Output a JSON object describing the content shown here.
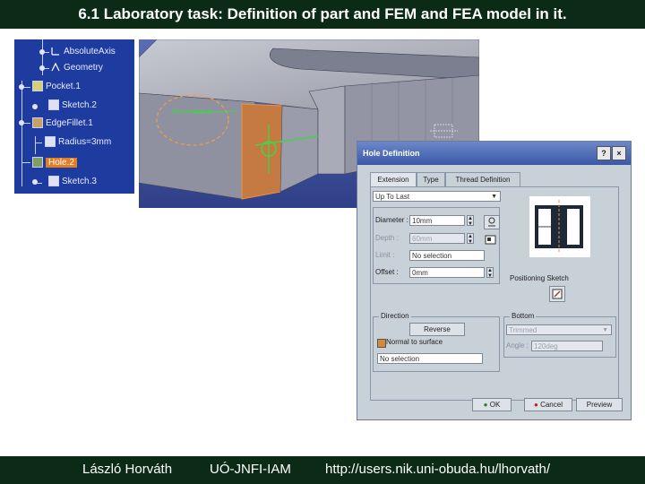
{
  "slide": {
    "title": "6.1 Laboratory task: Definition of part and FEM and FEA model in it.",
    "footer": {
      "author": "László Horváth",
      "institute": "UÓ-JNFI-IAM",
      "url": "http://users.nik.uni-obuda.hu/lhorvath/"
    }
  },
  "tree": {
    "items": [
      {
        "label": "AbsoluteAxis",
        "icon": "axis-icon"
      },
      {
        "label": "Geometry",
        "icon": "geometry-icon"
      },
      {
        "label": "Pocket.1",
        "icon": "pocket-icon"
      },
      {
        "label": "Sketch.2",
        "icon": "sketch-icon"
      },
      {
        "label": "EdgeFillet.1",
        "icon": "fillet-icon"
      },
      {
        "label": "Radius=3mm",
        "icon": "radius-icon"
      },
      {
        "label": "Hole.2",
        "icon": "hole-icon"
      },
      {
        "label": "Sketch.3",
        "icon": "sketch-icon"
      }
    ]
  },
  "dialog": {
    "title": "Hole Definition",
    "tabs": [
      "Extension",
      "Type",
      "Thread Definition"
    ],
    "extension_type": "Up To Last",
    "diameter_label": "Diameter :",
    "diameter_value": "10mm",
    "depth_label": "Depth :",
    "depth_value": "60mm",
    "limit_label": "Limit :",
    "limit_value": "No selection",
    "offset_label": "Offset :",
    "offset_value": "0mm",
    "positioning_sketch_label": "Positioning Sketch",
    "direction": {
      "caption": "Direction",
      "reverse_label": "Reverse",
      "normal_label": "Normal to surface",
      "selection_value": "No selection"
    },
    "bottom": {
      "caption": "Bottom",
      "type_value": "Trimmed",
      "angle_label": "Angle :",
      "angle_value": "120deg"
    },
    "ok_label": "OK",
    "cancel_label": "Cancel",
    "preview_label": "Preview",
    "help_glyph": "?",
    "close_glyph": "×"
  },
  "viewport": {
    "axis_label": "AbsoluteAxis",
    "colors": {
      "background": "#3e4f9e",
      "part": "#a7a9b6",
      "highlight": "#e98a2e",
      "axis": "#45d24a"
    }
  }
}
